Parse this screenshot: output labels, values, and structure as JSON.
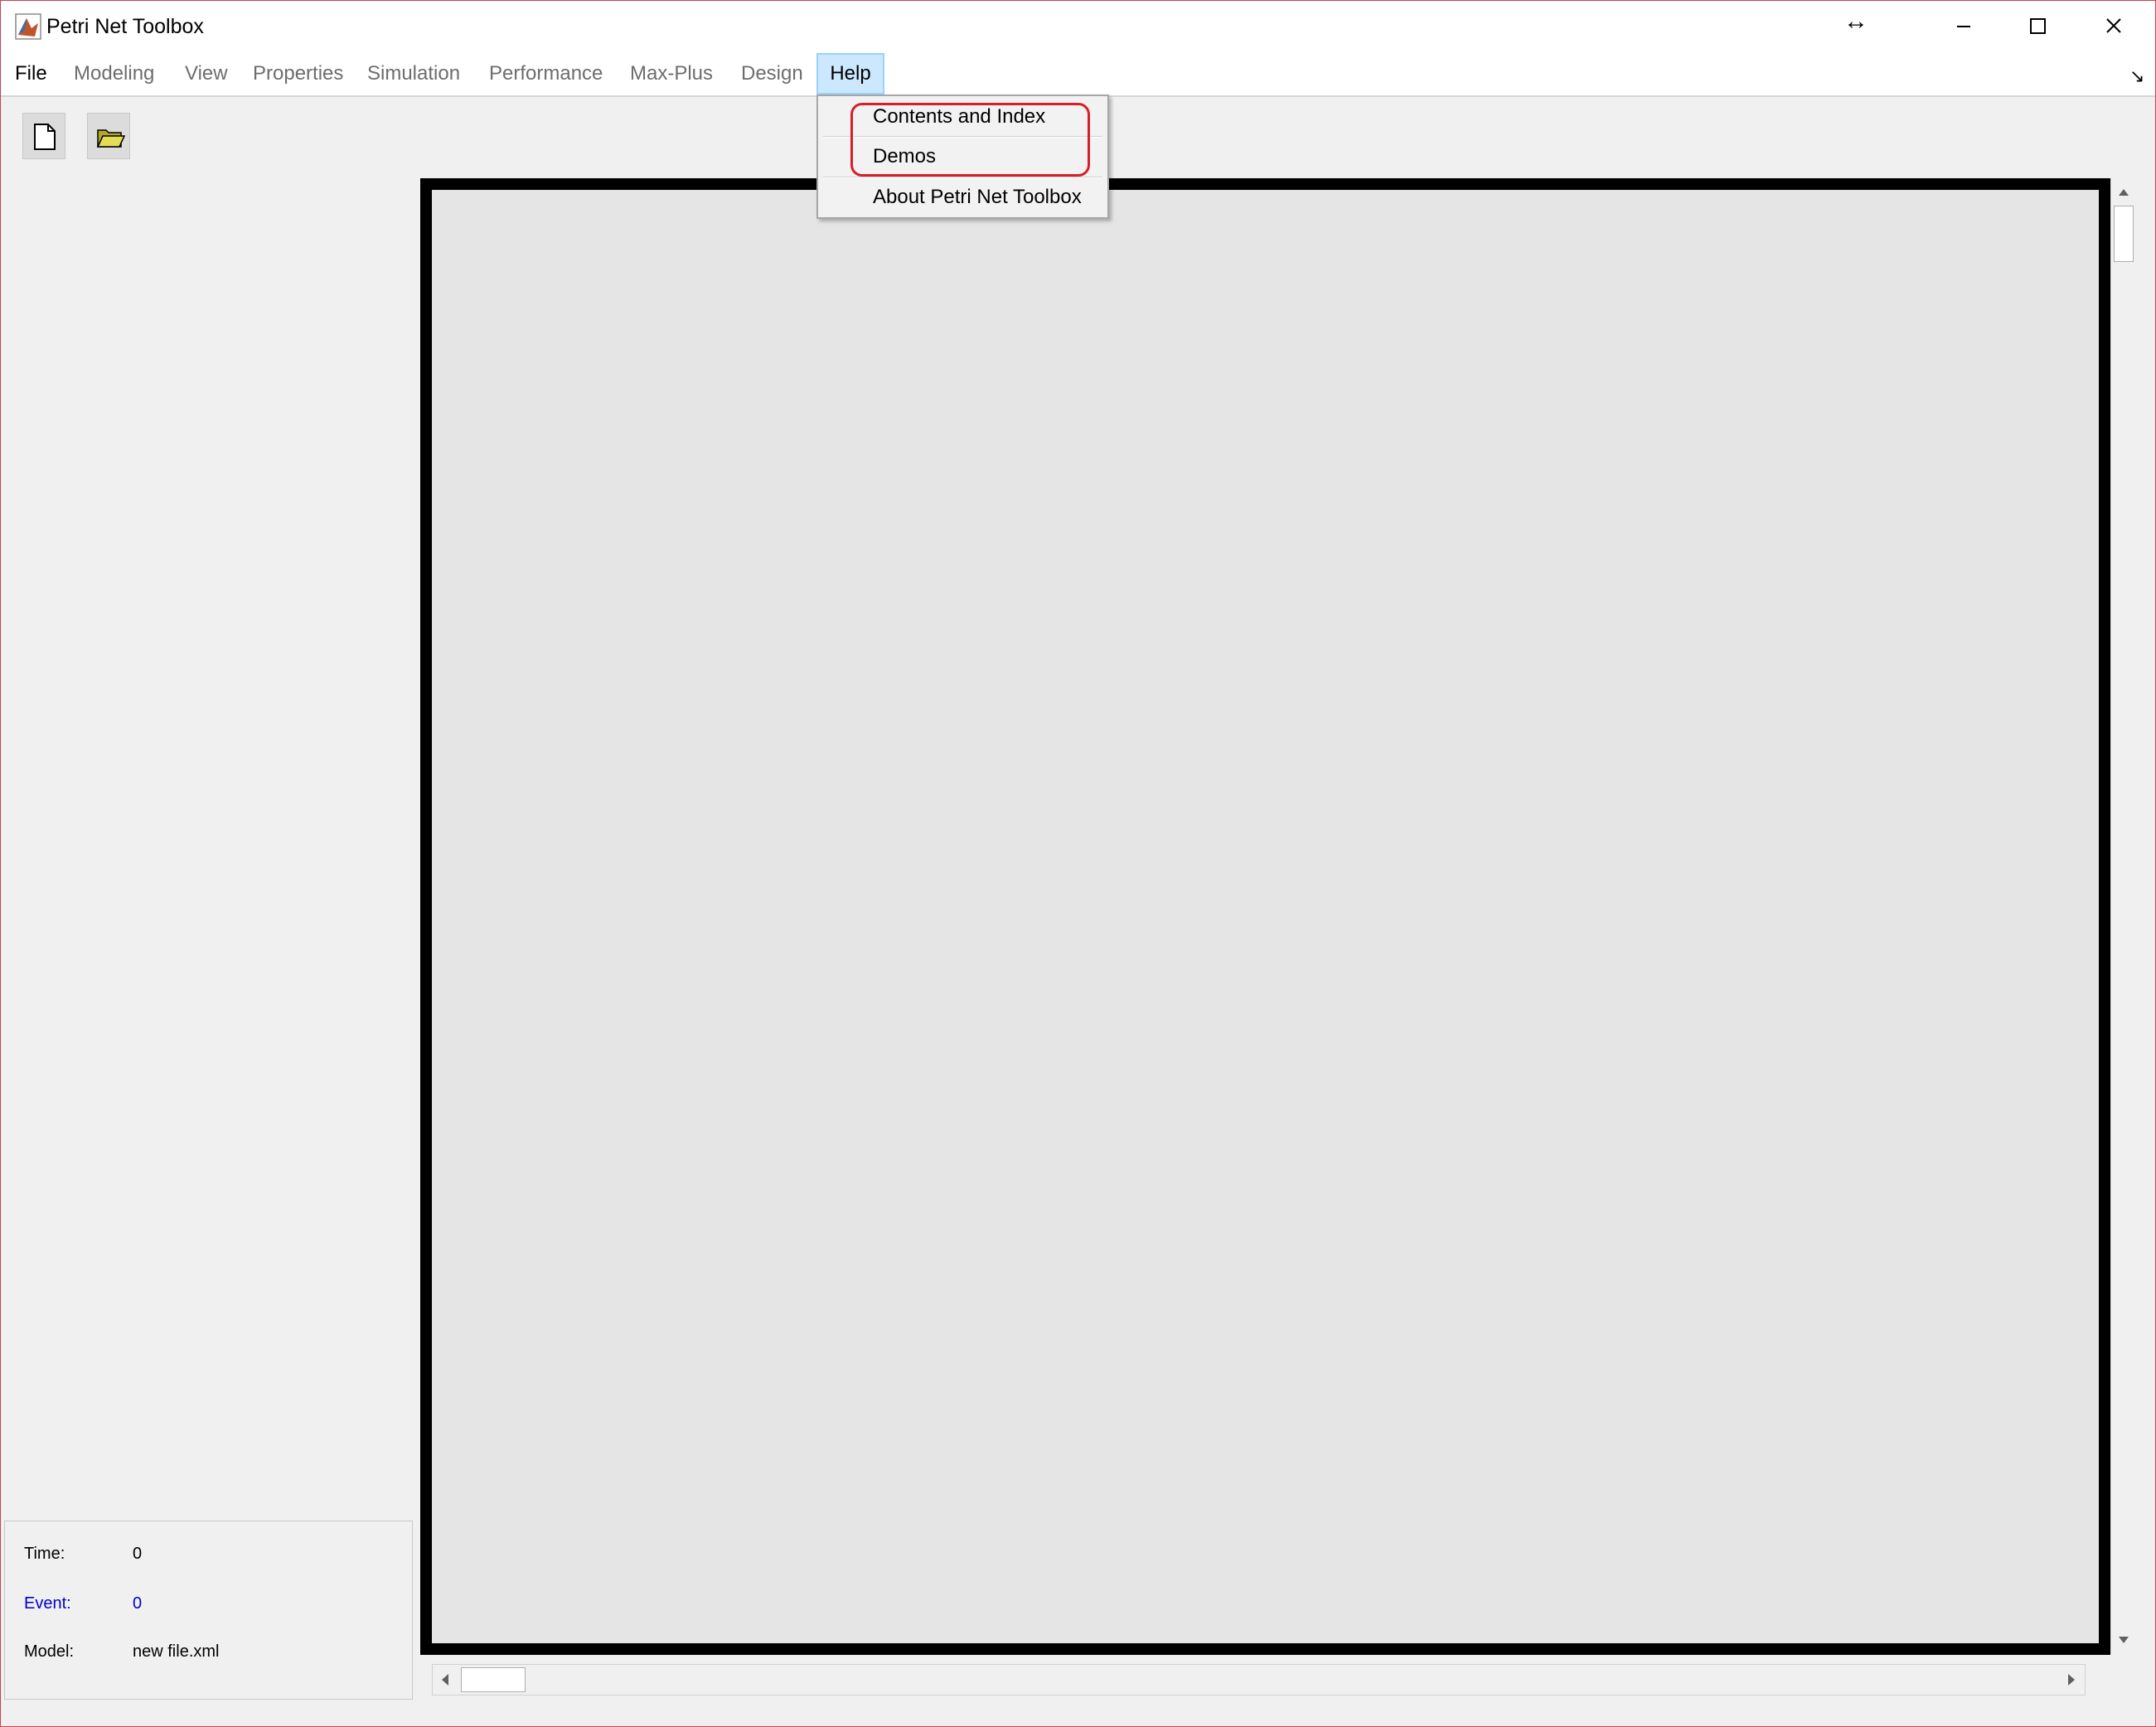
{
  "window": {
    "title": "Petri Net Toolbox",
    "controls": {
      "resize_glyph": "↔"
    }
  },
  "menubar": {
    "file": "File",
    "modeling": "Modeling",
    "view": "View",
    "properties": "Properties",
    "simulation": "Simulation",
    "performance": "Performance",
    "maxplus": "Max-Plus",
    "design": "Design",
    "help": "Help",
    "collapse_glyph": "↘"
  },
  "help_menu": {
    "items": [
      {
        "label": "Contents and Index"
      },
      {
        "label": "Demos"
      },
      {
        "label": "About Petri Net Toolbox"
      }
    ],
    "highlight_color": "#d61f2b"
  },
  "toolbar": {
    "icons": [
      "new-file-icon",
      "open-folder-icon"
    ]
  },
  "status": {
    "time_label": "Time:",
    "time_value": "0",
    "event_label": "Event:",
    "event_value": "0",
    "model_label": "Model:",
    "model_value": "new file.xml"
  },
  "colors": {
    "window_border": "#c8414c",
    "menu_hover": "#cce8ff",
    "event_text": "#0000c8",
    "canvas_bg": "#e5e5e5"
  }
}
